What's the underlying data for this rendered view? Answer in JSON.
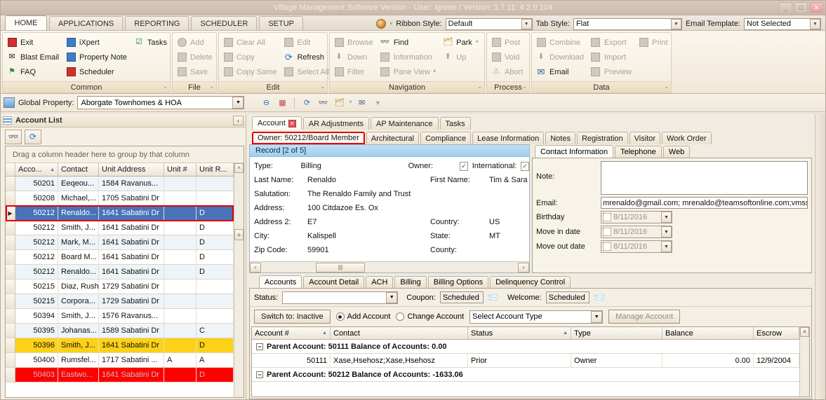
{
  "window": {
    "title": "Village Management Software Version - User: lgreen / Version: 1.7.11: 4.2.0.104",
    "minimize": "_",
    "maximize": "□",
    "close": "✕"
  },
  "main_tabs": [
    {
      "label": "HOME",
      "active": true
    },
    {
      "label": "APPLICATIONS",
      "active": false
    },
    {
      "label": "REPORTING",
      "active": false
    },
    {
      "label": "SCHEDULER",
      "active": false
    },
    {
      "label": "SETUP",
      "active": false
    }
  ],
  "settings_bar": {
    "ribbon_style_label": "Ribbon Style:",
    "ribbon_style_value": "Default",
    "tab_style_label": "Tab Style:",
    "tab_style_value": "Flat",
    "email_template_label": "Email Template:",
    "email_template_value": "Not Selected"
  },
  "ribbon": {
    "groups": [
      {
        "title": "Common",
        "items": [
          {
            "label": "Exit",
            "icon": "exit-icon",
            "disabled": false
          },
          {
            "label": "Blast Email",
            "icon": "blast-email-icon",
            "disabled": false
          },
          {
            "label": "FAQ",
            "icon": "faq-flag-icon",
            "disabled": false
          },
          {
            "label": "iXpert",
            "icon": "ixpert-icon",
            "disabled": false
          },
          {
            "label": "Property Note",
            "icon": "property-note-icon",
            "disabled": false
          },
          {
            "label": "Scheduler",
            "icon": "scheduler-icon",
            "disabled": false
          },
          {
            "label": "Tasks",
            "icon": "tasks-icon",
            "disabled": false
          }
        ]
      },
      {
        "title": "File",
        "items": [
          {
            "label": "Add",
            "icon": "add-icon",
            "disabled": true
          },
          {
            "label": "Delete",
            "icon": "delete-icon",
            "disabled": true
          },
          {
            "label": "Save",
            "icon": "save-icon",
            "disabled": true
          }
        ]
      },
      {
        "title": "Edit",
        "items": [
          {
            "label": "Clear All",
            "icon": "clear-all-icon",
            "disabled": true
          },
          {
            "label": "Copy",
            "icon": "copy-icon",
            "disabled": true
          },
          {
            "label": "Copy Same",
            "icon": "copy-same-icon",
            "disabled": true
          },
          {
            "label": "Edit",
            "icon": "edit-icon",
            "disabled": true
          },
          {
            "label": "Refresh",
            "icon": "refresh-icon",
            "disabled": false
          },
          {
            "label": "Select All",
            "icon": "select-all-icon",
            "disabled": true
          }
        ]
      },
      {
        "title": "Navigation",
        "items": [
          {
            "label": "Browse",
            "icon": "browse-folder-icon",
            "disabled": true
          },
          {
            "label": "Down",
            "icon": "arrow-down-icon",
            "disabled": true
          },
          {
            "label": "Filter",
            "icon": "filter-icon",
            "disabled": true
          },
          {
            "label": "Find",
            "icon": "find-binoculars-icon",
            "disabled": false
          },
          {
            "label": "Information",
            "icon": "information-icon",
            "disabled": true
          },
          {
            "label": "Pane View",
            "icon": "pane-view-icon",
            "disabled": true
          },
          {
            "label": "Park",
            "icon": "park-icon",
            "disabled": false
          },
          {
            "label": "Up",
            "icon": "arrow-up-icon",
            "disabled": true
          }
        ]
      },
      {
        "title": "Process",
        "items": [
          {
            "label": "Post",
            "icon": "post-icon",
            "disabled": true
          },
          {
            "label": "Void",
            "icon": "void-icon",
            "disabled": true
          },
          {
            "label": "Abort",
            "icon": "abort-warning-icon",
            "disabled": true
          }
        ]
      },
      {
        "title": "Data",
        "items": [
          {
            "label": "Combine",
            "icon": "combine-icon",
            "disabled": true
          },
          {
            "label": "Download",
            "icon": "download-icon",
            "disabled": true
          },
          {
            "label": "Email",
            "icon": "email-envelope-icon",
            "disabled": false
          },
          {
            "label": "Export",
            "icon": "export-icon",
            "disabled": true
          },
          {
            "label": "Import",
            "icon": "import-icon",
            "disabled": true
          },
          {
            "label": "Print",
            "icon": "print-icon",
            "disabled": true
          },
          {
            "label": "Preview",
            "icon": "preview-icon",
            "disabled": true
          }
        ]
      }
    ]
  },
  "global_property": {
    "label": "Global Property:",
    "value": "Aborgate Townhomes & HOA"
  },
  "left_panel": {
    "header": "Account List",
    "group_hint": "Drag a column header here to group by that column",
    "columns": [
      "Acco...",
      "Contact",
      "Unit Address",
      "Unit #",
      "Unit R..."
    ],
    "sort_column": "Acco...",
    "rows": [
      {
        "account": "50201",
        "contact": "Eeqeou...",
        "address": "1584 Ravanus...",
        "unit": "",
        "unitr": "",
        "style": "alt"
      },
      {
        "account": "50208",
        "contact": "Michael,...",
        "address": "1705 Sabatini Dr",
        "unit": "",
        "unitr": "",
        "style": ""
      },
      {
        "account": "50212",
        "contact": "Renaldo...",
        "address": "1641 Sabatini Dr",
        "unit": "",
        "unitr": "D",
        "style": "sel"
      },
      {
        "account": "50212",
        "contact": "Smith, J...",
        "address": "1641 Sabatini Dr",
        "unit": "",
        "unitr": "D",
        "style": ""
      },
      {
        "account": "50212",
        "contact": "Mark, M...",
        "address": "1641 Sabatini Dr",
        "unit": "",
        "unitr": "D",
        "style": "alt"
      },
      {
        "account": "50212",
        "contact": "Board M...",
        "address": "1641 Sabatini Dr",
        "unit": "",
        "unitr": "D",
        "style": ""
      },
      {
        "account": "50212",
        "contact": "Renaldo...",
        "address": "1641 Sabatini Dr",
        "unit": "",
        "unitr": "D",
        "style": "alt"
      },
      {
        "account": "50215",
        "contact": "Diaz, Rush",
        "address": "1729 Sabatini Dr",
        "unit": "",
        "unitr": "",
        "style": ""
      },
      {
        "account": "50215",
        "contact": "Corpora...",
        "address": "1729 Sabatini Dr",
        "unit": "",
        "unitr": "",
        "style": "alt"
      },
      {
        "account": "50394",
        "contact": "Smith, J...",
        "address": "1576 Ravanus...",
        "unit": "",
        "unitr": "",
        "style": ""
      },
      {
        "account": "50395",
        "contact": "Johanas...",
        "address": "1589 Sabatini Dr",
        "unit": "",
        "unitr": "C",
        "style": "alt"
      },
      {
        "account": "50396",
        "contact": "Smith, J...",
        "address": "1641 Sabatini Dr",
        "unit": "",
        "unitr": "D",
        "style": "yellow"
      },
      {
        "account": "50400",
        "contact": "Rumsfel...",
        "address": "1717 Sabatini ...",
        "unit": "A",
        "unitr": "A",
        "style": ""
      },
      {
        "account": "50403",
        "contact": "Eastwo...",
        "address": "1641 Sabatini Dr",
        "unit": "",
        "unitr": "D",
        "style": "red"
      }
    ]
  },
  "document_tabs": [
    {
      "label": "Account",
      "active": true,
      "closable": true
    },
    {
      "label": "AR Adjustments",
      "active": false,
      "closable": false
    },
    {
      "label": "AP Maintenance",
      "active": false,
      "closable": false
    },
    {
      "label": "Tasks",
      "active": false,
      "closable": false
    }
  ],
  "section_tabs": [
    {
      "label": "Owner:  50212/Board Member",
      "highlighted": true
    },
    {
      "label": "Architectural",
      "highlighted": false
    },
    {
      "label": "Compliance",
      "highlighted": false
    },
    {
      "label": "Lease Information",
      "highlighted": false
    },
    {
      "label": "Notes",
      "highlighted": false
    },
    {
      "label": "Registration",
      "highlighted": false
    },
    {
      "label": "Visitor",
      "highlighted": false
    },
    {
      "label": "Work Order",
      "highlighted": false
    }
  ],
  "record": {
    "header": "Record [2 of 5]",
    "fields": {
      "type_label": "Type:",
      "type_value": "Billing",
      "owner_label": "Owner:",
      "owner_checked": "✓",
      "international_label": "International:",
      "international_checked": "✓",
      "last_name_label": "Last Name:",
      "last_name_value": "Renaldo",
      "first_name_label": "First Name:",
      "first_name_value": "Tim & Sara",
      "salutation_label": "Salutation:",
      "salutation_value": "The Renaldo Family and Trust",
      "address_label": "Address:",
      "address_value": "100 Citdazoe Es. Ox",
      "address2_label": "Address 2:",
      "address2_value": "E7",
      "country_label": "Country:",
      "country_value": "US",
      "city_label": "City:",
      "city_value": "Kalispell",
      "state_label": "State:",
      "state_value": "MT",
      "zip_label": "Zip Code:",
      "zip_value": "59901",
      "county_label": "County:",
      "county_value": ""
    }
  },
  "contact_panel": {
    "tabs": [
      {
        "label": "Contact Information",
        "active": true
      },
      {
        "label": "Telephone",
        "active": false
      },
      {
        "label": "Web",
        "active": false
      }
    ],
    "note_label": "Note:",
    "note_value": "",
    "email_label": "Email:",
    "email_value": "mrenaldo@gmail.com; mrenaldo@teamsoftonline.com;vmssale",
    "birthday_label": "Birthday",
    "birthday_value": "8/11/2016",
    "move_in_label": "Move in date",
    "move_in_value": "8/11/2016",
    "move_out_label": "Move out date",
    "move_out_value": "8/11/2016"
  },
  "accounts_section": {
    "tabs": [
      {
        "label": "Accounts",
        "active": true
      },
      {
        "label": "Account Detail",
        "active": false
      },
      {
        "label": "ACH",
        "active": false
      },
      {
        "label": "Billing",
        "active": false
      },
      {
        "label": "Billing Options",
        "active": false
      },
      {
        "label": "Delinquency Control",
        "active": false
      }
    ],
    "status_label": "Status:",
    "status_value": "",
    "coupon_label": "Coupon:",
    "coupon_value": "Scheduled",
    "welcome_label": "Welcome:",
    "welcome_value": "Scheduled",
    "switch_button": "Switch to: Inactive",
    "add_account_radio": "Add Account",
    "change_account_radio": "Change Account",
    "account_type_value": "Select Account Type",
    "manage_account_button": "Manage Account"
  },
  "bottom_grid": {
    "columns": [
      "Account #",
      "Contact",
      "Status",
      "Type",
      "Balance",
      "Escrow"
    ],
    "groups": [
      {
        "label": "Parent Account: 50111 Balance of Accounts: 0.00",
        "rows": [
          {
            "account": "50111",
            "contact": "Xase,Hsehosz;Xase,Hsehosz",
            "status": "Prior",
            "type": "Owner",
            "balance": "0.00",
            "escrow": "12/9/2004"
          }
        ]
      },
      {
        "label": "Parent Account: 50212 Balance of Accounts: -1633.06",
        "rows": []
      }
    ]
  },
  "icons": {
    "search": "👓",
    "refresh": "⟳",
    "chevron_left": "‹",
    "chevron_right": "›",
    "chevron_up": "˄",
    "chevron_down": "˅",
    "grip": "≡",
    "sort_asc": "▲",
    "triangle_right": "▶",
    "envelope": "✉",
    "minus": "−",
    "dropdown": "▼"
  }
}
